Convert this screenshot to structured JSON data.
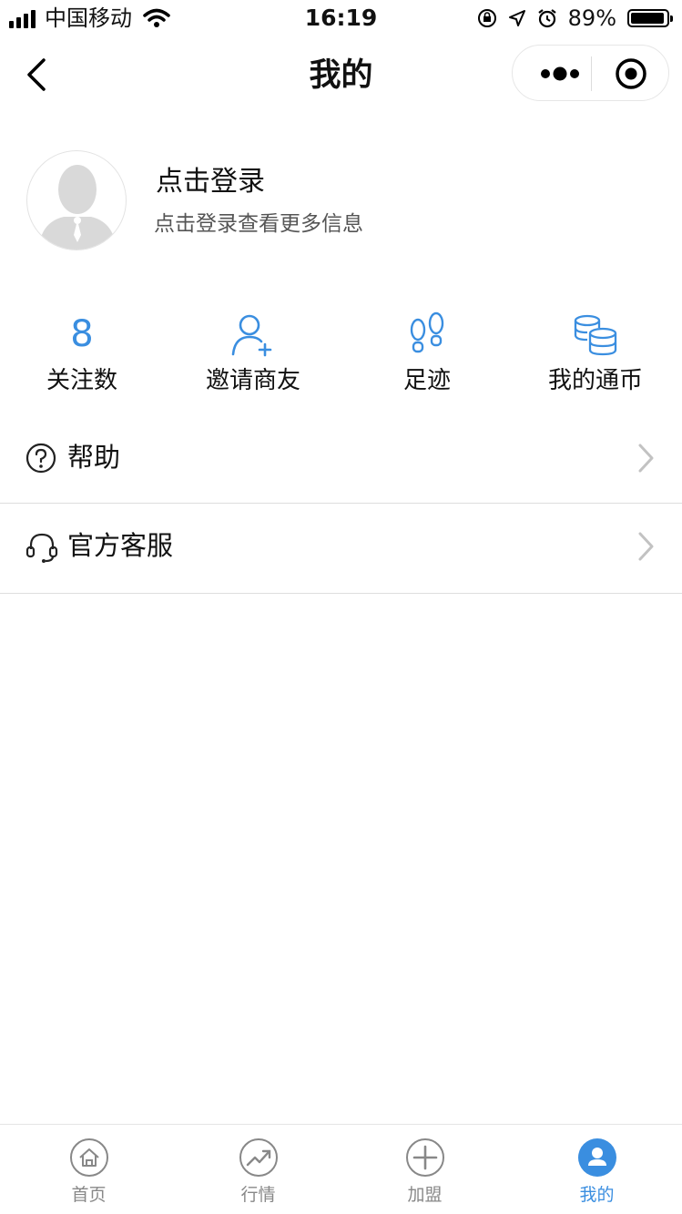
{
  "status_bar": {
    "carrier": "中国移动",
    "time": "16:19",
    "battery_percent": "89%"
  },
  "nav": {
    "title": "我的"
  },
  "profile": {
    "login_title": "点击登录",
    "login_subtitle": "点击登录查看更多信息"
  },
  "stats": [
    {
      "value": "8",
      "label": "关注数"
    },
    {
      "label": "邀请商友",
      "icon": "add-user-icon"
    },
    {
      "label": "足迹",
      "icon": "footprints-icon"
    },
    {
      "label": "我的通币",
      "icon": "coins-icon"
    }
  ],
  "menu": [
    {
      "label": "帮助",
      "icon": "help-circle-icon"
    },
    {
      "label": "官方客服",
      "icon": "headset-icon"
    }
  ],
  "tabbar": [
    {
      "label": "首页",
      "icon": "home-icon"
    },
    {
      "label": "行情",
      "icon": "trend-icon"
    },
    {
      "label": "加盟",
      "icon": "plus-icon"
    },
    {
      "label": "我的",
      "icon": "user-icon",
      "active": true
    }
  ],
  "colors": {
    "accent": "#3a8ee0",
    "text": "#111111",
    "muted": "#888888",
    "divider": "#dedede"
  }
}
